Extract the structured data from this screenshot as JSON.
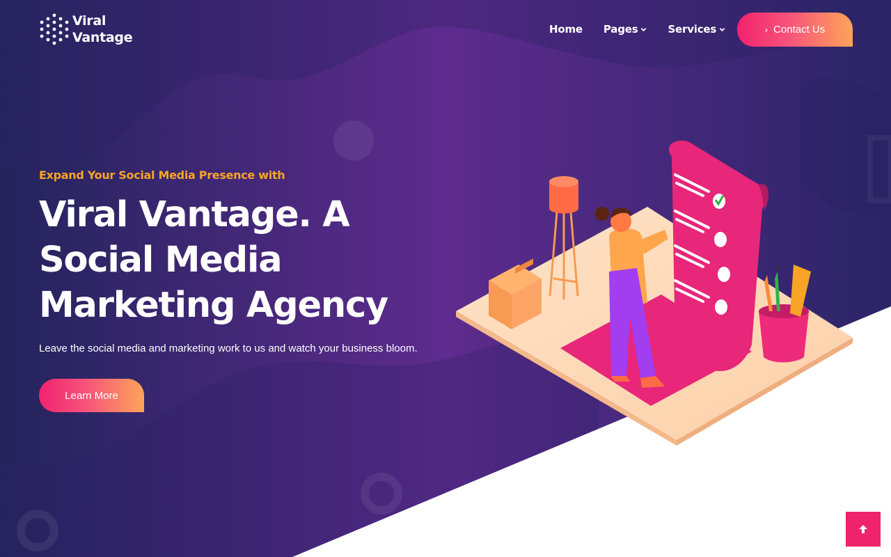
{
  "brand": {
    "name_line1": "Viral",
    "name_line2": "Vantage",
    "logo_icon": "dotted-hexagon-icon"
  },
  "nav": {
    "items": [
      {
        "label": "Home",
        "has_dropdown": false
      },
      {
        "label": "Pages",
        "has_dropdown": true
      },
      {
        "label": "Services",
        "has_dropdown": true
      }
    ],
    "contact_label": "Contact Us",
    "contact_icon": "chevron-right-icon"
  },
  "hero": {
    "subtitle": "Expand Your Social Media Presence with",
    "headline_lines": [
      "Viral Vantage. A",
      "Social Media",
      "Marketing Agency"
    ],
    "description": "Leave the social media and marketing work to us and watch your business bloom.",
    "cta_label": "Learn More",
    "illustration": "woman-checklist-isometric-illustration"
  },
  "scroll_top": {
    "icon": "arrow-up-icon"
  },
  "colors": {
    "bg_dark": "#24225f",
    "bg_purple": "#5b2b8c",
    "accent_orange": "#f8a426",
    "accent_pink": "#ee2369",
    "gradient_end": "#fda459"
  }
}
